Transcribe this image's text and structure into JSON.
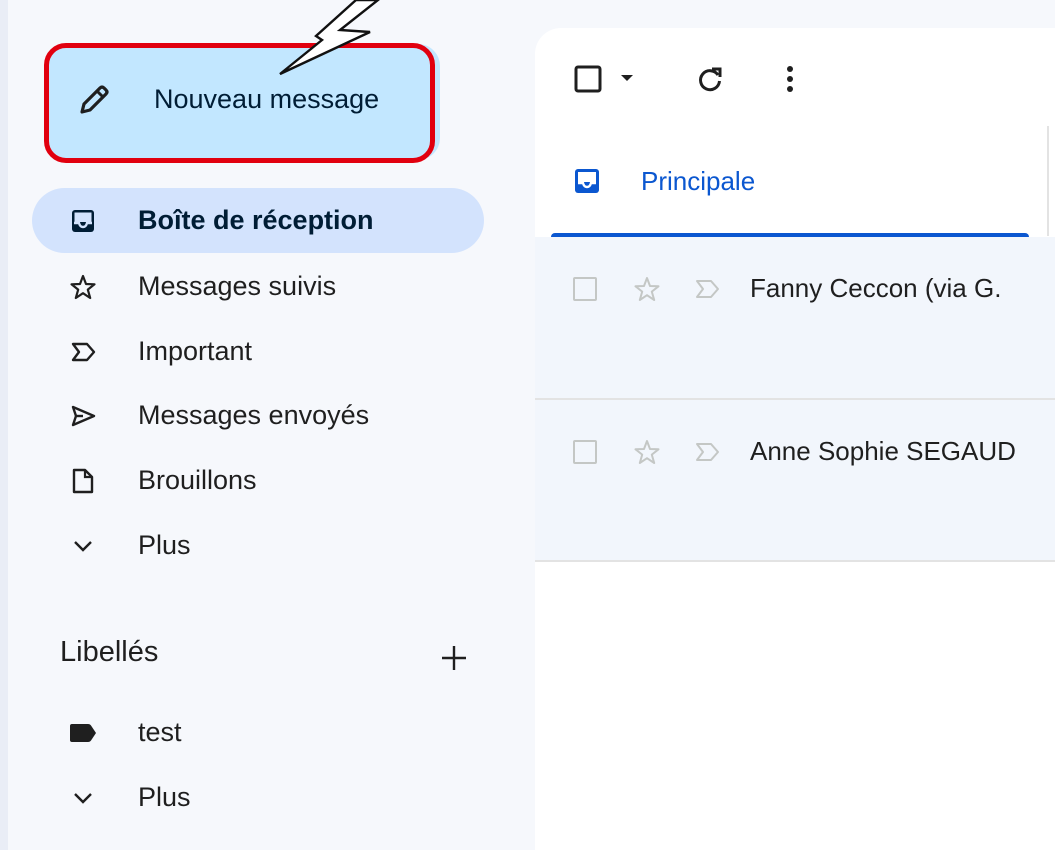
{
  "compose": {
    "label": "Nouveau message"
  },
  "nav": {
    "items": [
      {
        "label": "Boîte de réception",
        "icon": "inbox-icon",
        "active": true
      },
      {
        "label": "Messages suivis",
        "icon": "star-icon"
      },
      {
        "label": "Important",
        "icon": "important-icon"
      },
      {
        "label": "Messages envoyés",
        "icon": "send-icon"
      },
      {
        "label": "Brouillons",
        "icon": "draft-icon"
      },
      {
        "label": "Plus",
        "icon": "chevron-down-icon"
      }
    ]
  },
  "labels": {
    "title": "Libellés",
    "items": [
      {
        "label": "test",
        "icon": "label-icon"
      },
      {
        "label": "Plus",
        "icon": "chevron-down-icon"
      }
    ]
  },
  "main": {
    "toolbar": {
      "icons": [
        "select-checkbox-icon",
        "caret-down-icon",
        "refresh-icon",
        "more-vert-icon"
      ]
    },
    "tabs": [
      {
        "label": "Principale",
        "icon": "inbox-icon",
        "active": true
      }
    ],
    "emails": [
      {
        "sender": "Fanny Ceccon (via G."
      },
      {
        "sender": "Anne Sophie SEGAUD"
      }
    ]
  },
  "colors": {
    "compose_bg": "#c2e7ff",
    "active_nav_bg": "#d3e3fd",
    "highlight_border": "#e1000f",
    "accent_blue": "#0b57d0",
    "sidebar_bg": "#f6f8fc",
    "row_bg": "#f2f6fc"
  }
}
